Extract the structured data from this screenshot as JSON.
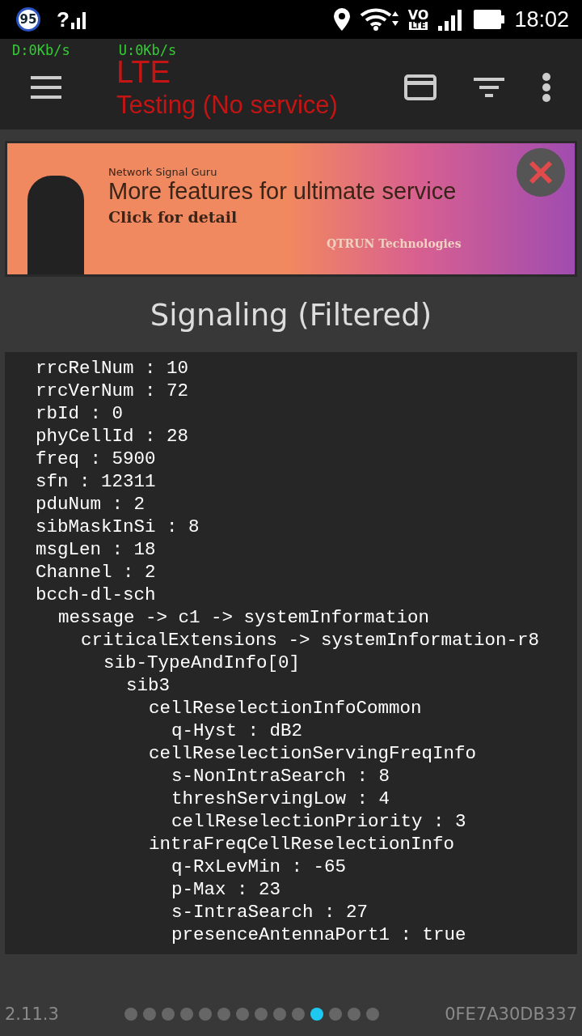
{
  "status_bar": {
    "badge": "95",
    "sim_mark": "?",
    "volte_top": "VO",
    "volte_bottom": "LTE",
    "time": "18:02"
  },
  "speed": {
    "download": "D:0Kb/s",
    "upload": "U:0Kb/s"
  },
  "app_bar": {
    "network": "LTE",
    "state": "Testing (No service)"
  },
  "banner": {
    "brand": "Network Signal Guru",
    "headline": "More features for ultimate service",
    "cta": "Click for detail",
    "company": "QTRUN Technologies"
  },
  "title": "Signaling (Filtered)",
  "message_detail": [
    {
      "text": "rrcRelNum : 10"
    },
    {
      "text": "rrcVerNum : 72"
    },
    {
      "text": "rbId : 0"
    },
    {
      "text": "phyCellId : 28"
    },
    {
      "text": "freq : 5900"
    },
    {
      "text": "sfn : 12311"
    },
    {
      "text": "pduNum : 2"
    },
    {
      "text": "sibMaskInSi : 8"
    },
    {
      "text": "msgLen : 18"
    },
    {
      "text": "Channel : 2"
    },
    {
      "text": "bcch-dl-sch",
      "children": [
        {
          "text": "message -> c1 -> systemInformation",
          "children": [
            {
              "text": "criticalExtensions -> systemInformation-r8",
              "children": [
                {
                  "text": "sib-TypeAndInfo[0]",
                  "children": [
                    {
                      "text": "sib3",
                      "children": [
                        {
                          "text": "cellReselectionInfoCommon",
                          "children": [
                            {
                              "text": "q-Hyst : dB2"
                            }
                          ]
                        },
                        {
                          "text": "cellReselectionServingFreqInfo",
                          "children": [
                            {
                              "text": "s-NonIntraSearch : 8"
                            },
                            {
                              "text": "threshServingLow : 4"
                            },
                            {
                              "text": "cellReselectionPriority : 3"
                            }
                          ]
                        },
                        {
                          "text": "intraFreqCellReselectionInfo",
                          "children": [
                            {
                              "text": "q-RxLevMin : -65"
                            },
                            {
                              "text": "p-Max : 23"
                            },
                            {
                              "text": "s-IntraSearch : 27"
                            },
                            {
                              "text": "presenceAntennaPort1 : true"
                            }
                          ]
                        }
                      ]
                    }
                  ]
                }
              ]
            }
          ]
        }
      ]
    }
  ],
  "footer": {
    "version": "2.11.3",
    "pages": [
      {
        "selected": false
      },
      {
        "selected": false
      },
      {
        "selected": false
      },
      {
        "selected": false
      },
      {
        "selected": false
      },
      {
        "selected": false
      },
      {
        "selected": false
      },
      {
        "selected": false
      },
      {
        "selected": false
      },
      {
        "selected": false
      },
      {
        "selected": true
      },
      {
        "selected": false
      },
      {
        "selected": false
      },
      {
        "selected": false
      }
    ],
    "device_id": "0FE7A30DB337"
  }
}
